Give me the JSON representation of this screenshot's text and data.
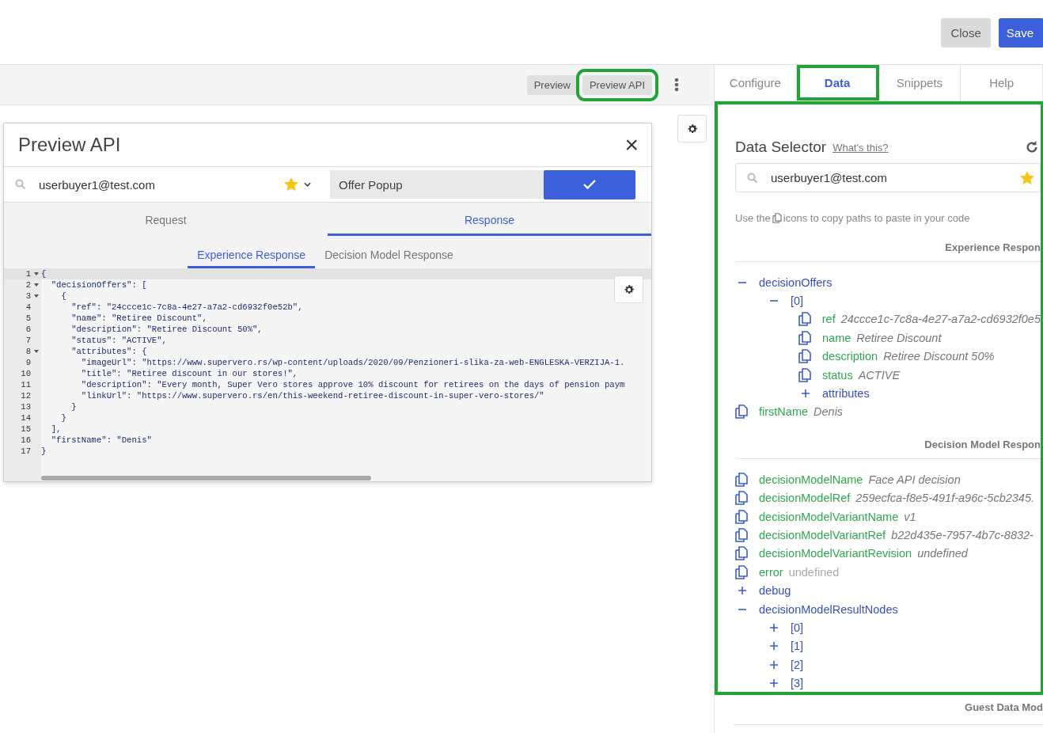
{
  "header": {
    "buttons": [
      {
        "label": "Close",
        "kind": "secondary"
      },
      {
        "label": "Save",
        "kind": "primary"
      }
    ]
  },
  "toolbar": {
    "buttons": [
      {
        "label": "Preview",
        "highlighted": false
      },
      {
        "label": "Preview API",
        "highlighted": true
      }
    ]
  },
  "modal": {
    "title": "Preview API",
    "close": "×",
    "user": "userbuyer1@test.com",
    "experience": "Offer Popup",
    "tabs": [
      {
        "label": "Request",
        "selected": false
      },
      {
        "label": "Response",
        "selected": true
      }
    ],
    "subtabs": [
      {
        "label": "Experience Response",
        "selected": true
      },
      {
        "label": "Decision Model Response",
        "selected": false
      }
    ],
    "code": [
      {
        "num": "1",
        "text": "{",
        "fold": true
      },
      {
        "num": "2",
        "text": "  \"decisionOffers\": [",
        "fold": true
      },
      {
        "num": "3",
        "text": "    {",
        "fold": true
      },
      {
        "num": "4",
        "text": "      \"ref\": \"24ccce1c-7c8a-4e27-a7a2-cd6932f0e52b\",",
        "fold": false
      },
      {
        "num": "5",
        "text": "      \"name\": \"Retiree Discount\",",
        "fold": false
      },
      {
        "num": "6",
        "text": "      \"description\": \"Retiree Discount 50%\",",
        "fold": false
      },
      {
        "num": "7",
        "text": "      \"status\": \"ACTIVE\",",
        "fold": false
      },
      {
        "num": "8",
        "text": "      \"attributes\": {",
        "fold": true
      },
      {
        "num": "9",
        "text": "        \"imageUrl\": \"https://www.supervero.rs/wp-content/uploads/2020/09/Penzioneri-slika-za-web-ENGLESKA-VERZIJA-1.",
        "fold": false
      },
      {
        "num": "10",
        "text": "        \"title\": \"Retiree discount in our stores!\",",
        "fold": false
      },
      {
        "num": "11",
        "text": "        \"description\": \"Every month, Super Vero stores approve 10% discount for retirees on the days of pension paym",
        "fold": false
      },
      {
        "num": "12",
        "text": "        \"linkUrl\": \"https://www.supervero.rs/en/this-weekend-retiree-discount-in-super-vero-stores/\"",
        "fold": false
      },
      {
        "num": "13",
        "text": "      }",
        "fold": false
      },
      {
        "num": "14",
        "text": "    }",
        "fold": false
      },
      {
        "num": "15",
        "text": "  ],",
        "fold": false
      },
      {
        "num": "16",
        "text": "  \"firstName\": \"Denis\"",
        "fold": false
      },
      {
        "num": "17",
        "text": "}",
        "fold": false
      }
    ]
  },
  "panel_tabs": [
    {
      "label": "Configure",
      "selected": false,
      "highlighted": false
    },
    {
      "label": "Data",
      "selected": true,
      "highlighted": true
    },
    {
      "label": "Snippets",
      "selected": false,
      "highlighted": false
    },
    {
      "label": "Help",
      "selected": false,
      "highlighted": false
    }
  ],
  "data_selector": {
    "highlighted": true,
    "title": "Data Selector",
    "help_link": "What's this?",
    "user": "userbuyer1@test.com",
    "hint_before": "Use the",
    "hint_after": "icons to copy paths to paste in your code",
    "sections": [
      {
        "heading": "Experience Respon",
        "items": [
          {
            "kind": "toggle",
            "key": "decisionOffers",
            "expanded": true,
            "children": [
              {
                "kind": "toggle",
                "key": "[0]",
                "expanded": true,
                "children": [
                  {
                    "kind": "copy",
                    "key": "ref",
                    "value": "24ccce1c-7c8a-4e27-a7a2-cd6932f0e5",
                    "italic": true
                  },
                  {
                    "kind": "copy",
                    "key": "name",
                    "value": "Retiree Discount",
                    "italic": true
                  },
                  {
                    "kind": "copy",
                    "key": "description",
                    "value": "Retiree Discount 50%",
                    "italic": true
                  },
                  {
                    "kind": "copy",
                    "key": "status",
                    "value": "ACTIVE",
                    "italic": true
                  },
                  {
                    "kind": "toggle",
                    "key": "attributes",
                    "expanded": false
                  }
                ]
              }
            ]
          },
          {
            "kind": "copy",
            "key": "firstName",
            "value": "Denis",
            "italic": true
          }
        ]
      },
      {
        "heading": "Decision Model Respon",
        "items": [
          {
            "kind": "copy",
            "key": "decisionModelName",
            "value": "Face API decision",
            "italic": true
          },
          {
            "kind": "copy",
            "key": "decisionModelRef",
            "value": "259ecfca-f8e5-491f-a96c-5cb2345.",
            "italic": true
          },
          {
            "kind": "copy",
            "key": "decisionModelVariantName",
            "value": "v1",
            "italic": true
          },
          {
            "kind": "copy",
            "key": "decisionModelVariantRef",
            "value": "b22d435e-7957-4b7c-8832-",
            "italic": true
          },
          {
            "kind": "copy",
            "key": "decisionModelVariantRevision",
            "value": "undefined",
            "italic": true
          },
          {
            "kind": "copy",
            "key": "error",
            "value": "undefined",
            "italic": false
          },
          {
            "kind": "toggle",
            "key": "debug",
            "expanded": false
          },
          {
            "kind": "toggle",
            "key": "decisionModelResultNodes",
            "expanded": true,
            "children": [
              {
                "kind": "toggle",
                "key": "[0]",
                "expanded": false
              },
              {
                "kind": "toggle",
                "key": "[1]",
                "expanded": false
              },
              {
                "kind": "toggle",
                "key": "[2]",
                "expanded": false
              },
              {
                "kind": "toggle",
                "key": "[3]",
                "expanded": false
              }
            ]
          }
        ]
      }
    ]
  },
  "after_heading": "Guest Data Mod"
}
